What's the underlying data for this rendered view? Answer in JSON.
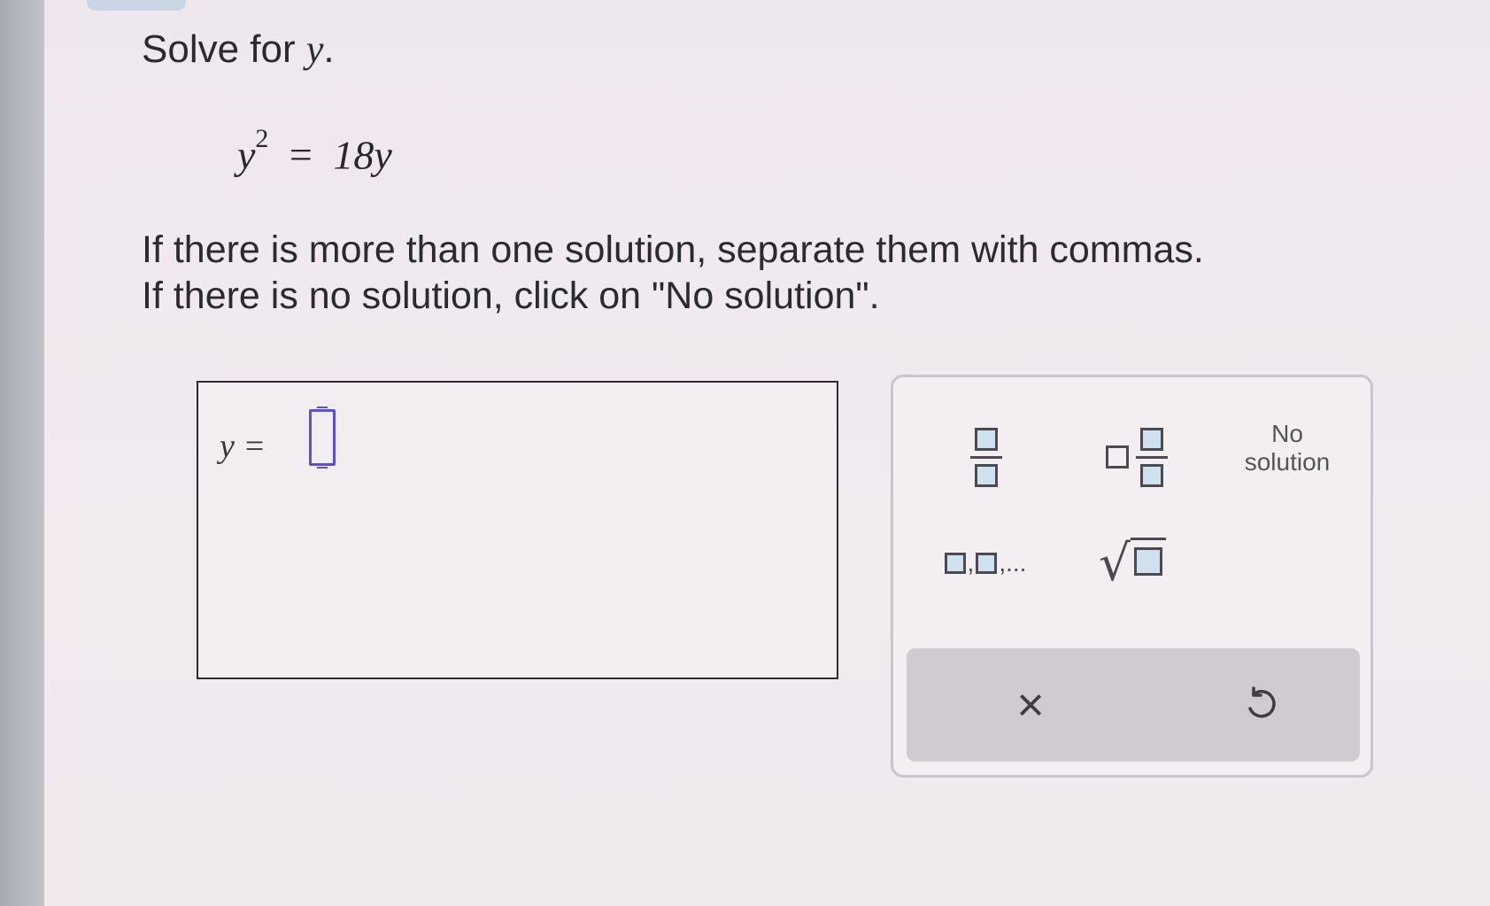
{
  "question": {
    "title_prefix": "Solve for ",
    "title_var": "y",
    "title_suffix": ".",
    "equation": {
      "lhs_base": "y",
      "lhs_exp": "2",
      "equals": "=",
      "rhs": "18y"
    },
    "instruction_line1": "If there is more than one solution, separate them with commas.",
    "instruction_line2": "If there is no solution, click on \"No solution\"."
  },
  "answer": {
    "label": "y =",
    "value": ""
  },
  "keypad": {
    "fraction_key": "fraction-icon",
    "mixed_number_key": "mixed-number-icon",
    "no_solution_line1": "No",
    "no_solution_line2": "solution",
    "list_separator": ",",
    "list_ellipsis": ",...",
    "sqrt_symbol": "√",
    "clear_symbol": "×",
    "undo_icon": "undo-icon"
  },
  "colors": {
    "accent_cursor": "#5a50d8",
    "placeholder_fill": "#cfe0ee"
  }
}
